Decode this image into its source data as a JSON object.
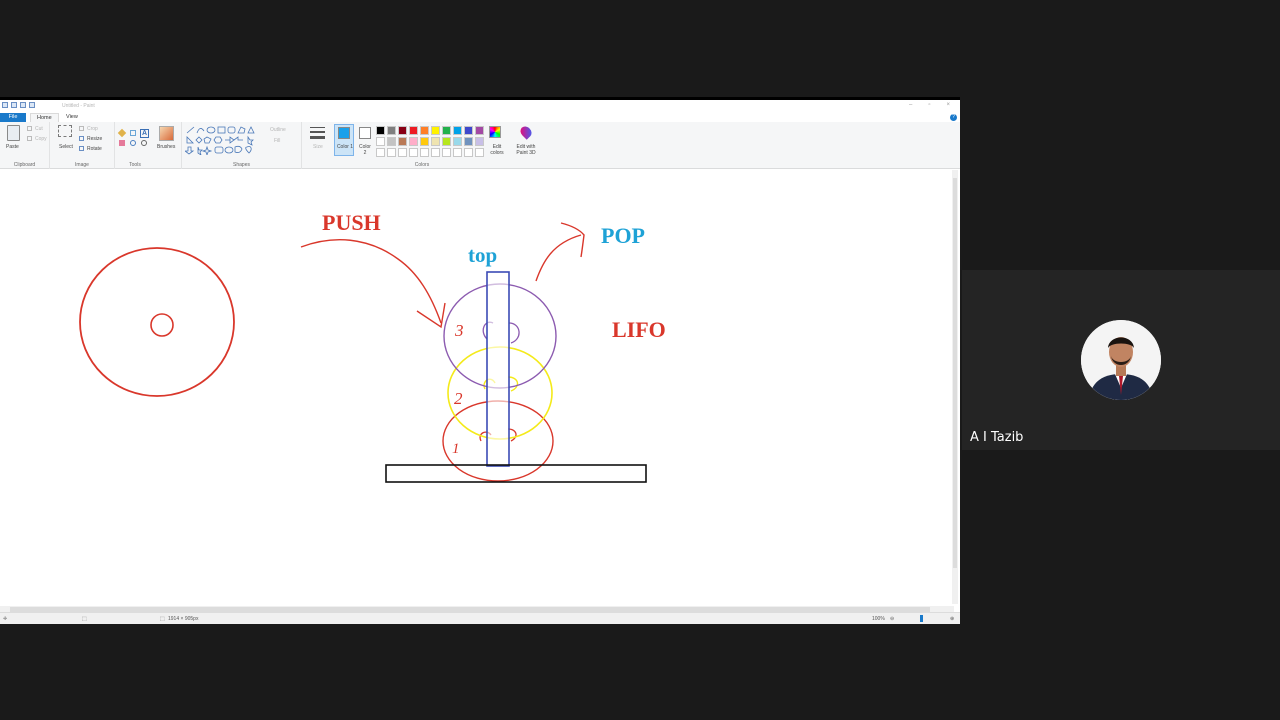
{
  "window": {
    "title": "Untitled - Paint"
  },
  "tabs": [
    "File",
    "Home",
    "View"
  ],
  "ribbon": {
    "clipboard": {
      "paste": "Paste",
      "cut": "Cut",
      "copy": "Copy",
      "label": "Clipboard"
    },
    "image": {
      "select": "Select",
      "crop": "Crop",
      "resize": "Resize",
      "rotate": "Rotate",
      "label": "Image"
    },
    "tools": {
      "brushes": "Brushes",
      "label": "Tools"
    },
    "shapes": {
      "outline": "Outline",
      "fill": "Fill",
      "label": "Shapes"
    },
    "size": "Size",
    "colors": {
      "color1": "Color 1",
      "color2": "Color 2",
      "edit_colors": "Edit colors",
      "edit_paint3d": "Edit with Paint 3D",
      "label": "Colors",
      "selected_color1": "#1aa0ea",
      "row1": [
        "#000000",
        "#7f7f7f",
        "#880015",
        "#ed1c24",
        "#ff7f27",
        "#fff200",
        "#22b14c",
        "#00a2e8",
        "#3f48cc",
        "#a349a4"
      ],
      "row2": [
        "#ffffff",
        "#c3c3c3",
        "#b97a57",
        "#ffaec9",
        "#ffc90e",
        "#efe4b0",
        "#b5e61d",
        "#99d9ea",
        "#7092be",
        "#c8bfe7"
      ]
    }
  },
  "canvas": {
    "labels": {
      "push": "PUSH",
      "pop": "POP",
      "top": "top",
      "lifo": "LIFO",
      "n1": "1",
      "n2": "2",
      "n3": "3"
    },
    "colors": {
      "red": "#d9372b",
      "blue": "#1ea2d6",
      "purple": "#8c5bb0",
      "yellow": "#f4ea1a",
      "rod": "#3b4bb5"
    }
  },
  "status": {
    "dimensions": "1914 × 905px",
    "zoom": "100%"
  },
  "participant": {
    "name": "A I Tazib"
  }
}
